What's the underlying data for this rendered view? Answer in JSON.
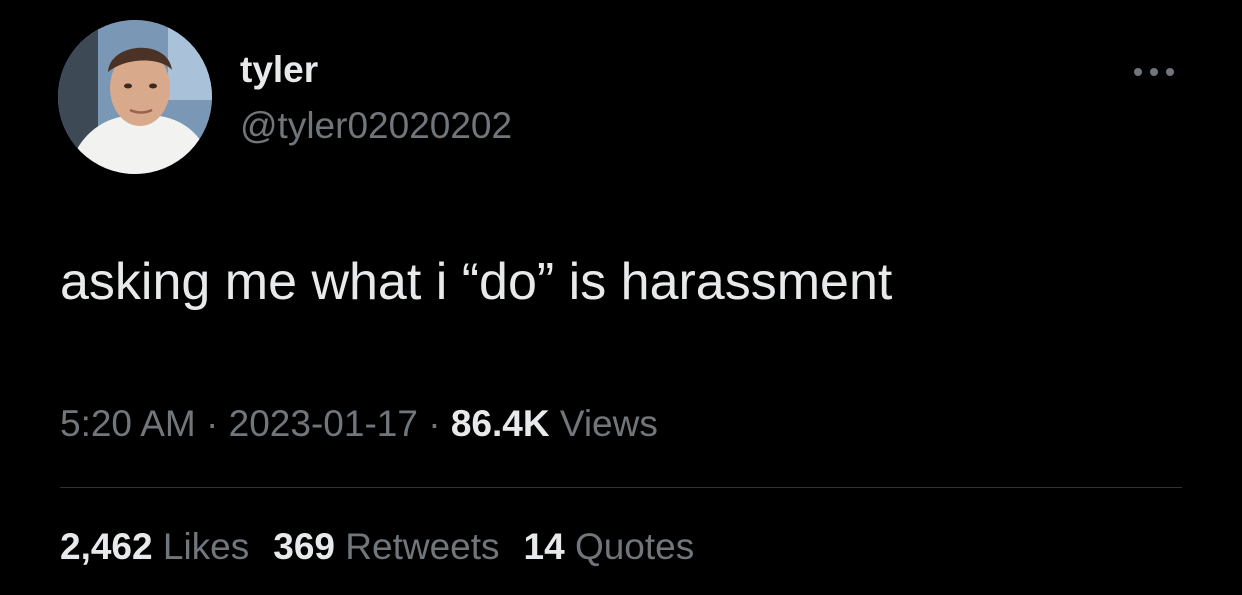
{
  "author": {
    "display_name": "tyler",
    "handle": "@tyler02020202",
    "avatar_icon": "profile-photo"
  },
  "tweet": {
    "text": "asking me what i “do” is harassment"
  },
  "meta": {
    "time": "5:20 AM",
    "separator": "·",
    "date": "2023-01-17",
    "views_count": "86.4K",
    "views_label": "Views"
  },
  "stats": {
    "likes_count": "2,462",
    "likes_label": "Likes",
    "retweets_count": "369",
    "retweets_label": "Retweets",
    "quotes_count": "14",
    "quotes_label": "Quotes"
  },
  "icons": {
    "more": "more-options-icon"
  },
  "colors": {
    "background": "#000000",
    "primary_text": "#e7e9ea",
    "secondary_text": "#71767b",
    "divider": "#2f3336"
  }
}
